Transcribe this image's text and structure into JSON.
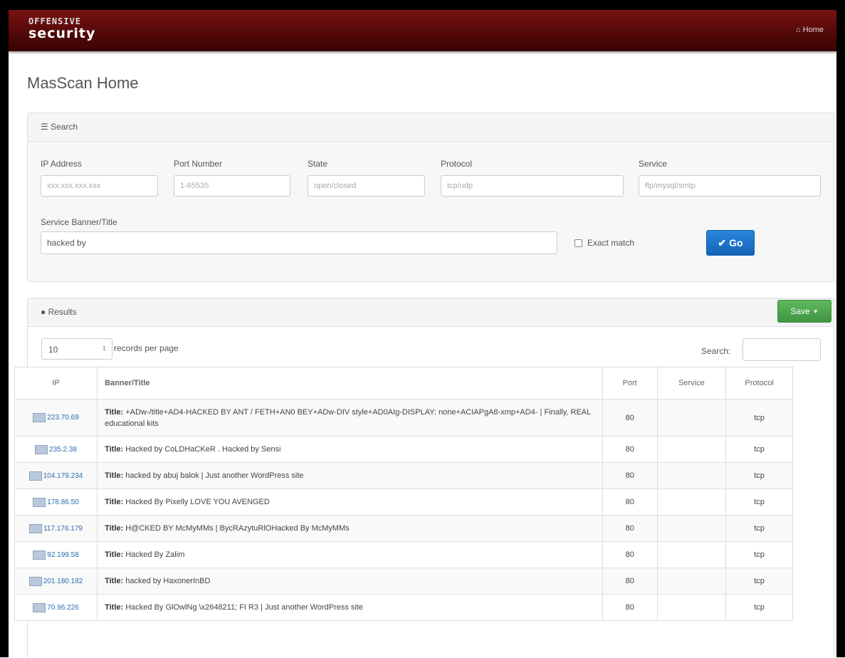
{
  "navbar": {
    "logo_top": "OFFENSIVE",
    "logo_main": "security",
    "home_icon": "home-icon",
    "home_label": "Home"
  },
  "page_title": "MasScan Home",
  "search_panel": {
    "heading_icon": "list-icon",
    "heading": "Search",
    "fields": {
      "ip": {
        "label": "IP Address",
        "placeholder": "xxx.xxx.xxx.xxx",
        "value": ""
      },
      "port": {
        "label": "Port Number",
        "placeholder": "1-65535",
        "value": ""
      },
      "state": {
        "label": "State",
        "placeholder": "open/closed",
        "value": ""
      },
      "protocol": {
        "label": "Protocol",
        "placeholder": "tcp/udp",
        "value": ""
      },
      "service": {
        "label": "Service",
        "placeholder": "ftp/mysql/smtp",
        "value": ""
      },
      "banner": {
        "label": "Service Banner/Title",
        "value": "hacked by"
      }
    },
    "exact_match_label": "Exact match",
    "exact_match_checked": false,
    "go_icon": "check-icon",
    "go_label": "Go",
    "go_color": "#1d73c9"
  },
  "results_panel": {
    "heading_icon": "globe-icon",
    "heading": "Results",
    "save_label": "Save",
    "save_color": "#4cae4c",
    "records_value": "10",
    "records_label": "records per page",
    "search_label": "Search:",
    "columns": [
      "IP",
      "Banner/Title",
      "Port",
      "Service",
      "Protocol"
    ],
    "title_prefix": "Title:",
    "rows": [
      {
        "ip": "223.70.69",
        "banner": "+ADw-/title+AD4-HACKED BY ANT / FETH+AN0 BEY+ADw-DIV style+AD0AIg-DISPLAY: none+ACIAPgA8-xmp+AD4- | Finally, REAL educational kits",
        "port": "80",
        "service": "",
        "protocol": "tcp"
      },
      {
        "ip": "235.2.38",
        "banner": "Hacked by CoLDHaCKeR . Hacked by Sensi",
        "port": "80",
        "service": "",
        "protocol": "tcp"
      },
      {
        "ip": "104.179.234",
        "banner": "hacked by abuj balok | Just another WordPress site",
        "port": "80",
        "service": "",
        "protocol": "tcp"
      },
      {
        "ip": "178.86.50",
        "banner": "Hacked By Pixelly LOVE YOU AVENGED",
        "port": "80",
        "service": "",
        "protocol": "tcp"
      },
      {
        "ip": "117.176.179",
        "banner": "H@CKED BY McMyMMs | BycRAzytuRlOHacked By McMyMMs",
        "port": "80",
        "service": "",
        "protocol": "tcp"
      },
      {
        "ip": "92.199.58",
        "banner": "Hacked By Zalim",
        "port": "80",
        "service": "",
        "protocol": "tcp"
      },
      {
        "ip": "201.180.182",
        "banner": "hacked by HaxonerInBD",
        "port": "80",
        "service": "",
        "protocol": "tcp"
      },
      {
        "ip": "70.96.226",
        "banner": "Hacked By GlOwlNg \\x2648211; FI R3 | Just another WordPress site",
        "port": "80",
        "service": "",
        "protocol": "tcp"
      }
    ]
  }
}
